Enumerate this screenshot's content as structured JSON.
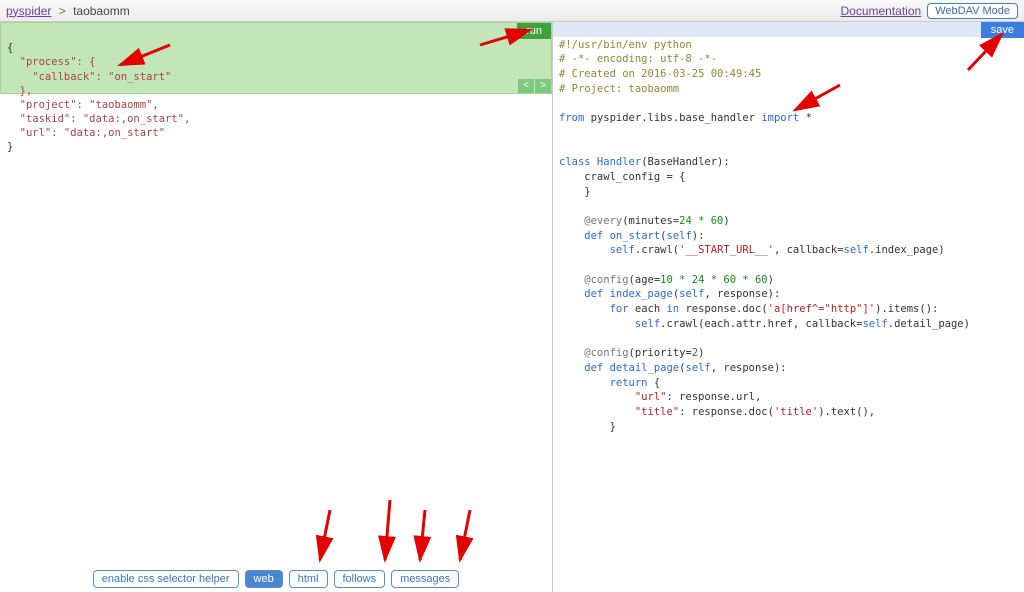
{
  "header": {
    "home_link": "pyspider",
    "separator": ">",
    "project": "taobaomm",
    "documentation": "Documentation",
    "webdav": "WebDAV Mode"
  },
  "left": {
    "run_label": "run",
    "prev": "<",
    "next": ">",
    "task_lines": {
      "l0": "{",
      "l1": "  \"process\": {",
      "l2": "    \"callback\": \"on_start\"",
      "l3": "  },",
      "l4": "  \"project\": \"taobaomm\",",
      "l5": "  \"taskid\": \"data:,on_start\",",
      "l6": "  \"url\": \"data:,on_start\"",
      "l7": "}"
    },
    "tabs": {
      "css_helper": "enable css selector helper",
      "web": "web",
      "html": "html",
      "follows": "follows",
      "messages": "messages"
    }
  },
  "right": {
    "save_label": "save",
    "code": {
      "c0": "#!/usr/bin/env python",
      "c1": "# -*- encoding: utf-8 -*-",
      "c2": "# Created on 2016-03-25 00:49:45",
      "c3": "# Project: taobaomm",
      "c4_a": "from",
      "c4_b": " pyspider.libs.base_handler ",
      "c4_c": "import",
      "c4_d": " *",
      "c5_a": "class",
      "c5_b": " Handler",
      "c5_c": "(BaseHandler):",
      "c6": "    crawl_config = {",
      "c7": "    }",
      "c8_a": "    @every",
      "c8_b": "(minutes=",
      "c8_num": "24 * 60",
      "c8_c": ")",
      "c9_a": "    def",
      "c9_b": " on_start",
      "c9_c": "(",
      "c9_self": "self",
      "c9_d": "):",
      "c10_a": "        ",
      "c10_self": "self",
      "c10_b": ".crawl(",
      "c10_str": "'__START_URL__'",
      "c10_c": ", callback=",
      "c10_self2": "self",
      "c10_d": ".index_page)",
      "c11_a": "    @config",
      "c11_b": "(age=",
      "c11_num": "10 * 24 * 60 * 60",
      "c11_c": ")",
      "c12_a": "    def",
      "c12_b": " index_page",
      "c12_c": "(",
      "c12_self": "self",
      "c12_d": ", response):",
      "c13_a": "        for",
      "c13_b": " each ",
      "c13_in": "in",
      "c13_c": " response.doc(",
      "c13_str": "'a[href^=\"http\"]'",
      "c13_d": ").items():",
      "c14_a": "            ",
      "c14_self": "self",
      "c14_b": ".crawl(each.attr.href, callback=",
      "c14_self2": "self",
      "c14_c": ".detail_page)",
      "c15_a": "    @config",
      "c15_b": "(priority=",
      "c15_num": "2",
      "c15_c": ")",
      "c16_a": "    def",
      "c16_b": " detail_page",
      "c16_c": "(",
      "c16_self": "self",
      "c16_d": ", response):",
      "c17_a": "        return",
      "c17_b": " {",
      "c18_a": "            ",
      "c18_str": "\"url\"",
      "c18_b": ": response.url,",
      "c19_a": "            ",
      "c19_str": "\"title\"",
      "c19_b": ": response.doc(",
      "c19_str2": "'title'",
      "c19_c": ").text(),",
      "c20": "        }"
    }
  }
}
